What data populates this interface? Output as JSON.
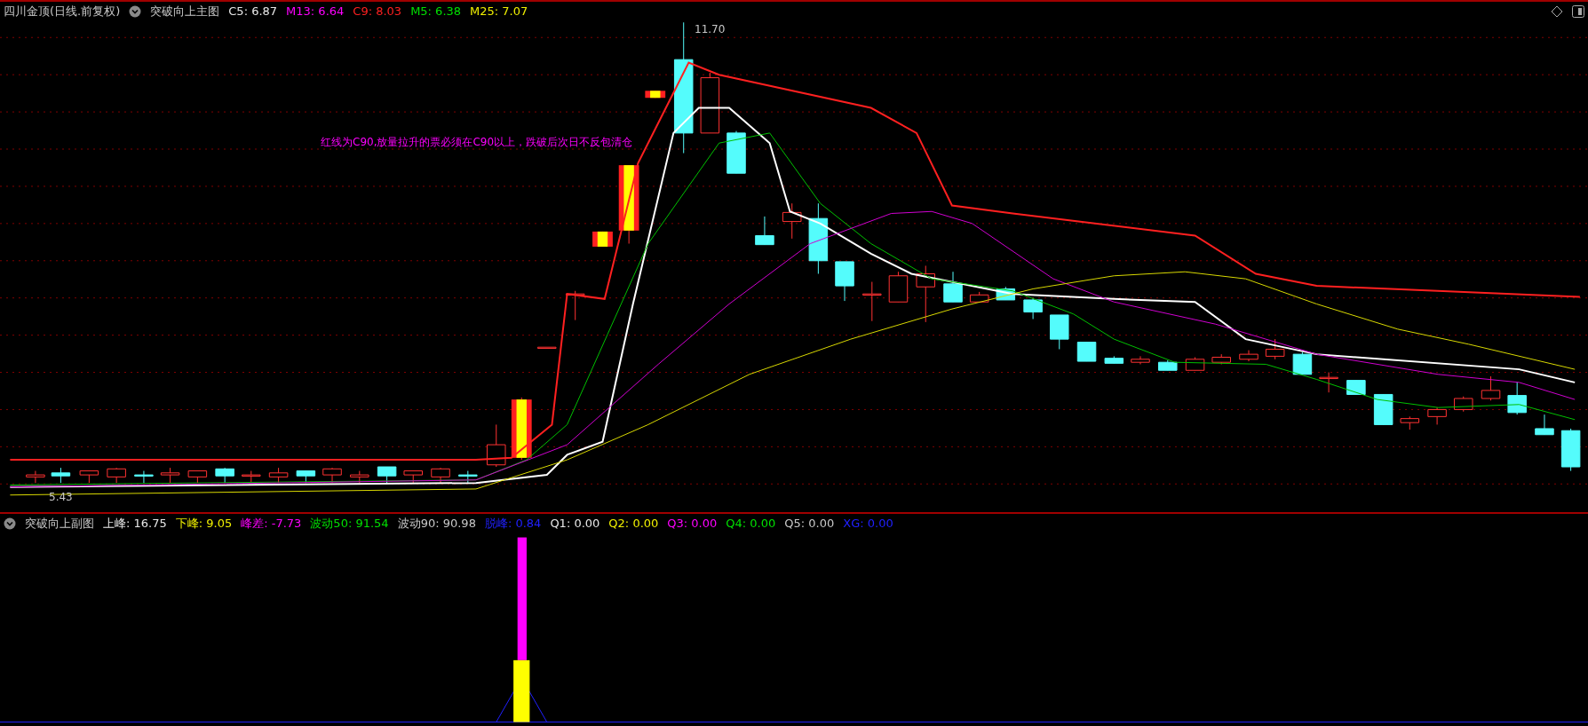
{
  "header": {
    "stock": "四川金顶(日线.前复权)",
    "indicator": "突破向上主图",
    "values": [
      {
        "text": "C5: 6.87",
        "color": "#e8e8e8"
      },
      {
        "text": "M13: 6.64",
        "color": "#ff00ff"
      },
      {
        "text": "C9: 8.03",
        "color": "#ff2020"
      },
      {
        "text": "M5: 6.38",
        "color": "#00e000"
      },
      {
        "text": "M25: 7.07",
        "color": "#f0f000"
      }
    ]
  },
  "main_chart": {
    "high_label": "11.70",
    "low_label": "5.43",
    "note": "红线为C90,放量拉升的票必须在C90以上，跌破后次日不反包清仓"
  },
  "sub_header": {
    "indicator": "突破向上副图",
    "values": [
      {
        "text": "上峰: 16.75",
        "color": "#e8e8e8"
      },
      {
        "text": "下峰: 9.05",
        "color": "#f0f000"
      },
      {
        "text": "峰差: -7.73",
        "color": "#ff00ff"
      },
      {
        "text": "波动50: 91.54",
        "color": "#00e000"
      },
      {
        "text": "波动90: 90.98",
        "color": "#c8c8c8"
      },
      {
        "text": "脱峰: 0.84",
        "color": "#2020ff"
      },
      {
        "text": "Q1: 0.00",
        "color": "#e8e8e8"
      },
      {
        "text": "Q2: 0.00",
        "color": "#f0f000"
      },
      {
        "text": "Q3: 0.00",
        "color": "#ff00ff"
      },
      {
        "text": "Q4: 0.00",
        "color": "#00e000"
      },
      {
        "text": "Q5: 0.00",
        "color": "#c8c8c8"
      },
      {
        "text": "XG: 0.00",
        "color": "#2020ff"
      }
    ]
  }
}
